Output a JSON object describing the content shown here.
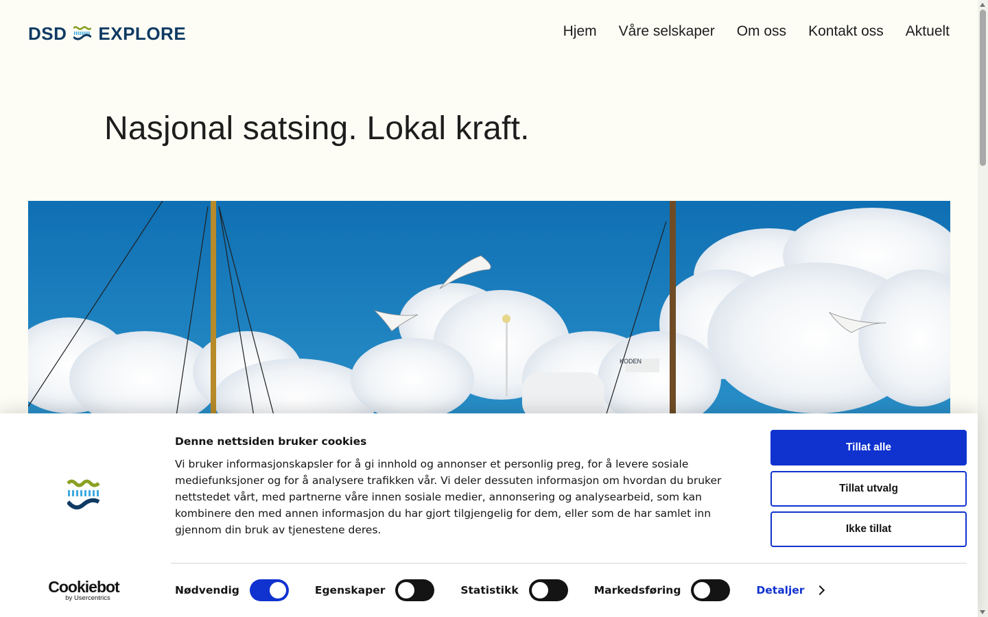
{
  "header": {
    "logo_left": "DSD",
    "logo_right": "EXPLORE",
    "nav": [
      "Hjem",
      "Våre selskaper",
      "Om oss",
      "Kontakt oss",
      "Aktuelt"
    ]
  },
  "main": {
    "headline": "Nasjonal satsing. Lokal kraft.",
    "hero_image": "boat-masts-seagulls-sky",
    "hero_boat_label": "KODEN"
  },
  "cookie_banner": {
    "title": "Denne nettsiden bruker cookies",
    "text": "Vi bruker informasjonskapsler for å gi innhold og annonser et personlig preg, for å levere sosiale mediefunksjoner og for å analysere trafikken vår. Vi deler dessuten informasjon om hvordan du bruker nettstedet vårt, med partnerne våre innen sosiale medier, annonsering og analysearbeid, som kan kombinere den med annen informasjon du har gjort tilgjengelig for dem, eller som de har samlet inn gjennom din bruk av tjenestene deres.",
    "buttons": {
      "allow_all": "Tillat alle",
      "allow_selection": "Tillat utvalg",
      "deny": "Ikke tillat"
    },
    "toggles": [
      {
        "label": "Nødvendig",
        "on": true
      },
      {
        "label": "Egenskaper",
        "on": false
      },
      {
        "label": "Statistikk",
        "on": false
      },
      {
        "label": "Markedsføring",
        "on": false
      }
    ],
    "details_label": "Detaljer",
    "brand": {
      "name": "Cookiebot",
      "by": "by Usercentrics"
    },
    "accent_color": "#1032cf"
  },
  "colors": {
    "logo_navy": "#0f3a63",
    "logo_green": "#8aa024",
    "logo_blue": "#3fa9e0"
  }
}
